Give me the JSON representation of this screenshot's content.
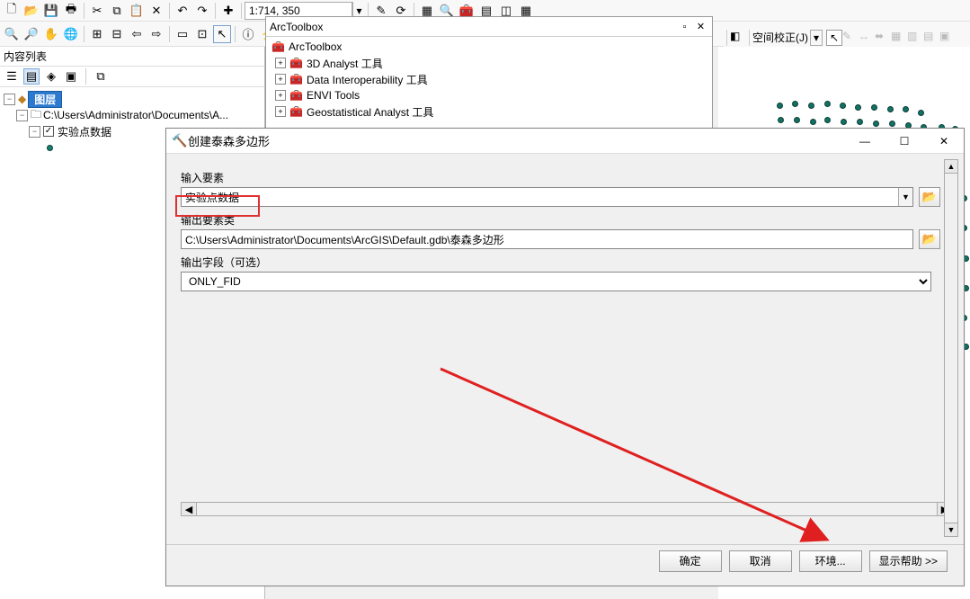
{
  "toolbar": {
    "scale_value": "1:714, 350"
  },
  "spatial_toolbar": {
    "label": "空间校正(J)"
  },
  "toc": {
    "title": "内容列表",
    "root": "图层",
    "dataset": "C:\\Users\\Administrator\\Documents\\A...",
    "layer": "实验点数据"
  },
  "toolbox": {
    "title": "ArcToolbox",
    "root": "ArcToolbox",
    "items": [
      "3D Analyst 工具",
      "Data Interoperability 工具",
      "ENVI Tools",
      "Geostatistical Analyst 工具"
    ]
  },
  "dialog": {
    "title": "创建泰森多边形",
    "input_label": "输入要素",
    "input_value": "实验点数据",
    "output_label": "输出要素类",
    "output_value": "C:\\Users\\Administrator\\Documents\\ArcGIS\\Default.gdb\\泰森多边形",
    "outfield_label": "输出字段（可选）",
    "outfield_value": "ONLY_FID",
    "ok": "确定",
    "cancel": "取消",
    "env": "环境...",
    "help": "显示帮助 >>"
  }
}
